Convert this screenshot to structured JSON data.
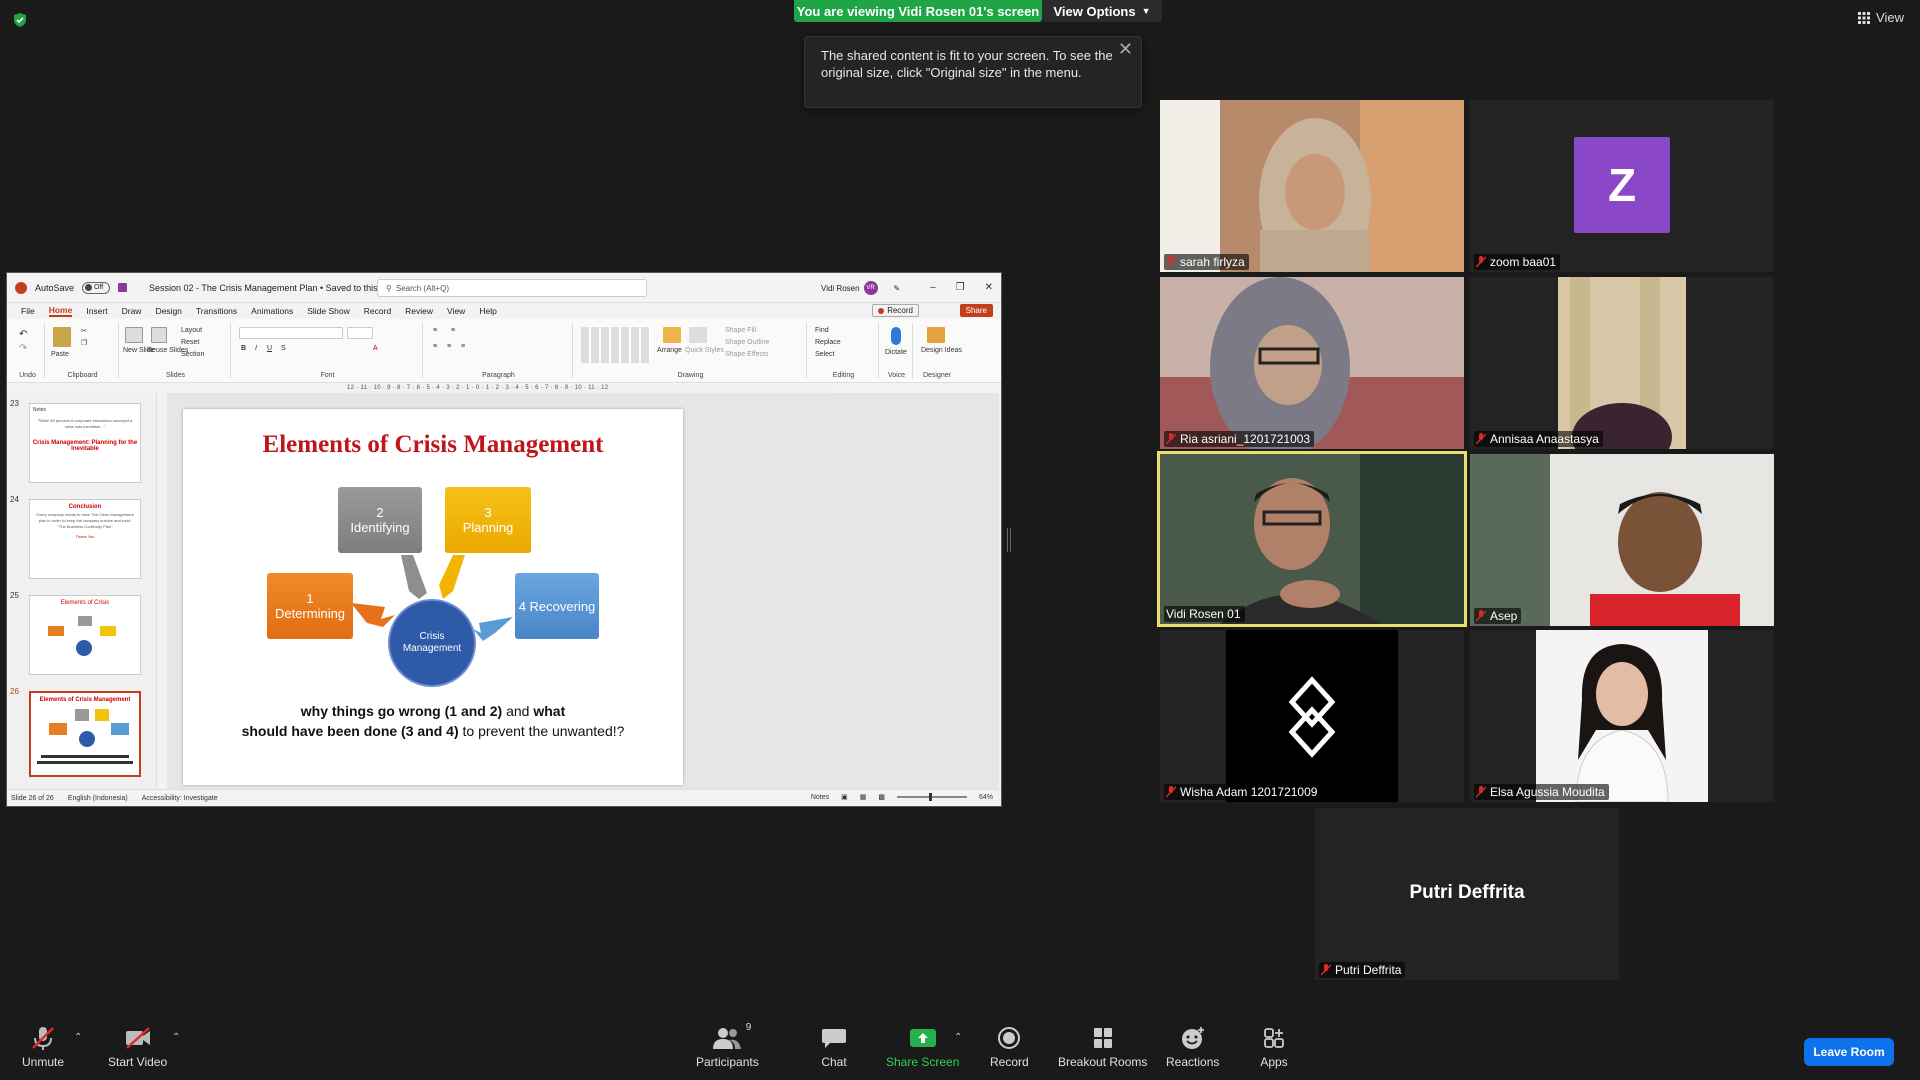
{
  "banner": {
    "viewing": "You are viewing Vidi Rosen 01's screen",
    "view_options": "View Options",
    "view_top_right": "View"
  },
  "tooltip": {
    "text": "The shared content is fit to your screen. To see the original size, click \"Original size\" in the menu."
  },
  "ppt": {
    "autosave": "AutoSave",
    "autosave_state": "Off",
    "doc_title": "Session 02 - The Crisis Management Plan • Saved to this PC",
    "search_placeholder": "Search (Alt+Q)",
    "user_name": "Vidi Rosen",
    "user_initials": "VR",
    "tabs": [
      "File",
      "Home",
      "Insert",
      "Draw",
      "Design",
      "Transitions",
      "Animations",
      "Slide Show",
      "Record",
      "Review",
      "View",
      "Help"
    ],
    "record_label": "Record",
    "share_label": "Share",
    "ribbon": {
      "undo": "Undo",
      "clipboard": "Clipboard",
      "paste": "Paste",
      "slides": "Slides",
      "new_slide": "New Slide",
      "reuse_slides": "Reuse Slides",
      "layout": "Layout",
      "reset": "Reset",
      "section": "Section",
      "font": "Font",
      "paragraph": "Paragraph",
      "drawing": "Drawing",
      "arrange": "Arrange",
      "quick_styles": "Quick Styles",
      "shape_fill": "Shape Fill",
      "shape_outline": "Shape Outline",
      "shape_effects": "Shape Effects",
      "editing": "Editing",
      "find": "Find",
      "replace": "Replace",
      "select": "Select",
      "voice": "Voice",
      "dictate": "Dictate",
      "designer": "Designer",
      "design_ideas": "Design Ideas"
    },
    "ruler_text": "12 · 11 · 10 · 9 · 8 · 7 · 6 · 5 · 4 · 3 · 2 · 1 · 0 · 1 · 2 · 3 · 4 · 5 · 6 · 7 · 8 · 9 · 10 · 11 · 12",
    "thumbnails": [
      {
        "num": "23",
        "title": "Crisis Management: Planning for the Inevitable",
        "body": "\"While 89 percent of corporate executives surveyed a crisis was inevitable...\"",
        "heading": "Notes"
      },
      {
        "num": "24",
        "title": "Conclusion",
        "body": "Every company needs to have The Crisis Management plan in order to keep the company survive and exist. \"The Business Continuity Plan\"",
        "footer": "Thank You"
      },
      {
        "num": "25",
        "title": "Elements of Crisis",
        "body": ""
      },
      {
        "num": "26",
        "title": "Elements of Crisis Management",
        "body": ""
      }
    ],
    "slide": {
      "title": "Elements of Crisis Management",
      "box1": "1\nDetermining",
      "box2": "2\nIdentifying",
      "box3": "3\nPlanning",
      "box4": "4 Recovering",
      "center": "Crisis Management",
      "footer_line1_bold": "why things go wrong (1 and 2)",
      "footer_line1_mid": " and ",
      "footer_line1_bold2": "what",
      "footer_line2_bold": "should have been done (3 and 4)",
      "footer_line2_rest": " to prevent the unwanted!?"
    },
    "status": {
      "slide_count": "Slide 26 of 26",
      "language": "English (Indonesia)",
      "accessibility": "Accessibility: Investigate",
      "notes": "Notes",
      "zoom": "64%"
    }
  },
  "participants": [
    {
      "name": "sarah firlyza",
      "muted": true
    },
    {
      "name": "zoom baa01",
      "muted": true,
      "initial": "Z"
    },
    {
      "name": "Ria asriani_1201721003",
      "muted": true
    },
    {
      "name": "Annisaa Anaastasya",
      "muted": true
    },
    {
      "name": "Vidi Rosen 01",
      "muted": false,
      "speaker": true
    },
    {
      "name": "Asep",
      "muted": true
    },
    {
      "name": "Wisha Adam 1201721009",
      "muted": true
    },
    {
      "name": "Elsa Agussia Moudita",
      "muted": true
    },
    {
      "name": "Putri Deffrita",
      "muted": true,
      "label": "Putri Deffrita"
    }
  ],
  "toolbar": {
    "unmute": "Unmute",
    "start_video": "Start Video",
    "participants": "Participants",
    "participants_count": "9",
    "chat": "Chat",
    "share_screen": "Share Screen",
    "record": "Record",
    "breakout_rooms": "Breakout Rooms",
    "reactions": "Reactions",
    "apps": "Apps",
    "leave_room": "Leave Room"
  },
  "colors": {
    "banner_green": "#1fa546",
    "speaker_border": "#e8e06a",
    "leave_blue": "#0e72ed",
    "ppt_accent": "#c43e1c",
    "slide_title_red": "#c0161b"
  }
}
